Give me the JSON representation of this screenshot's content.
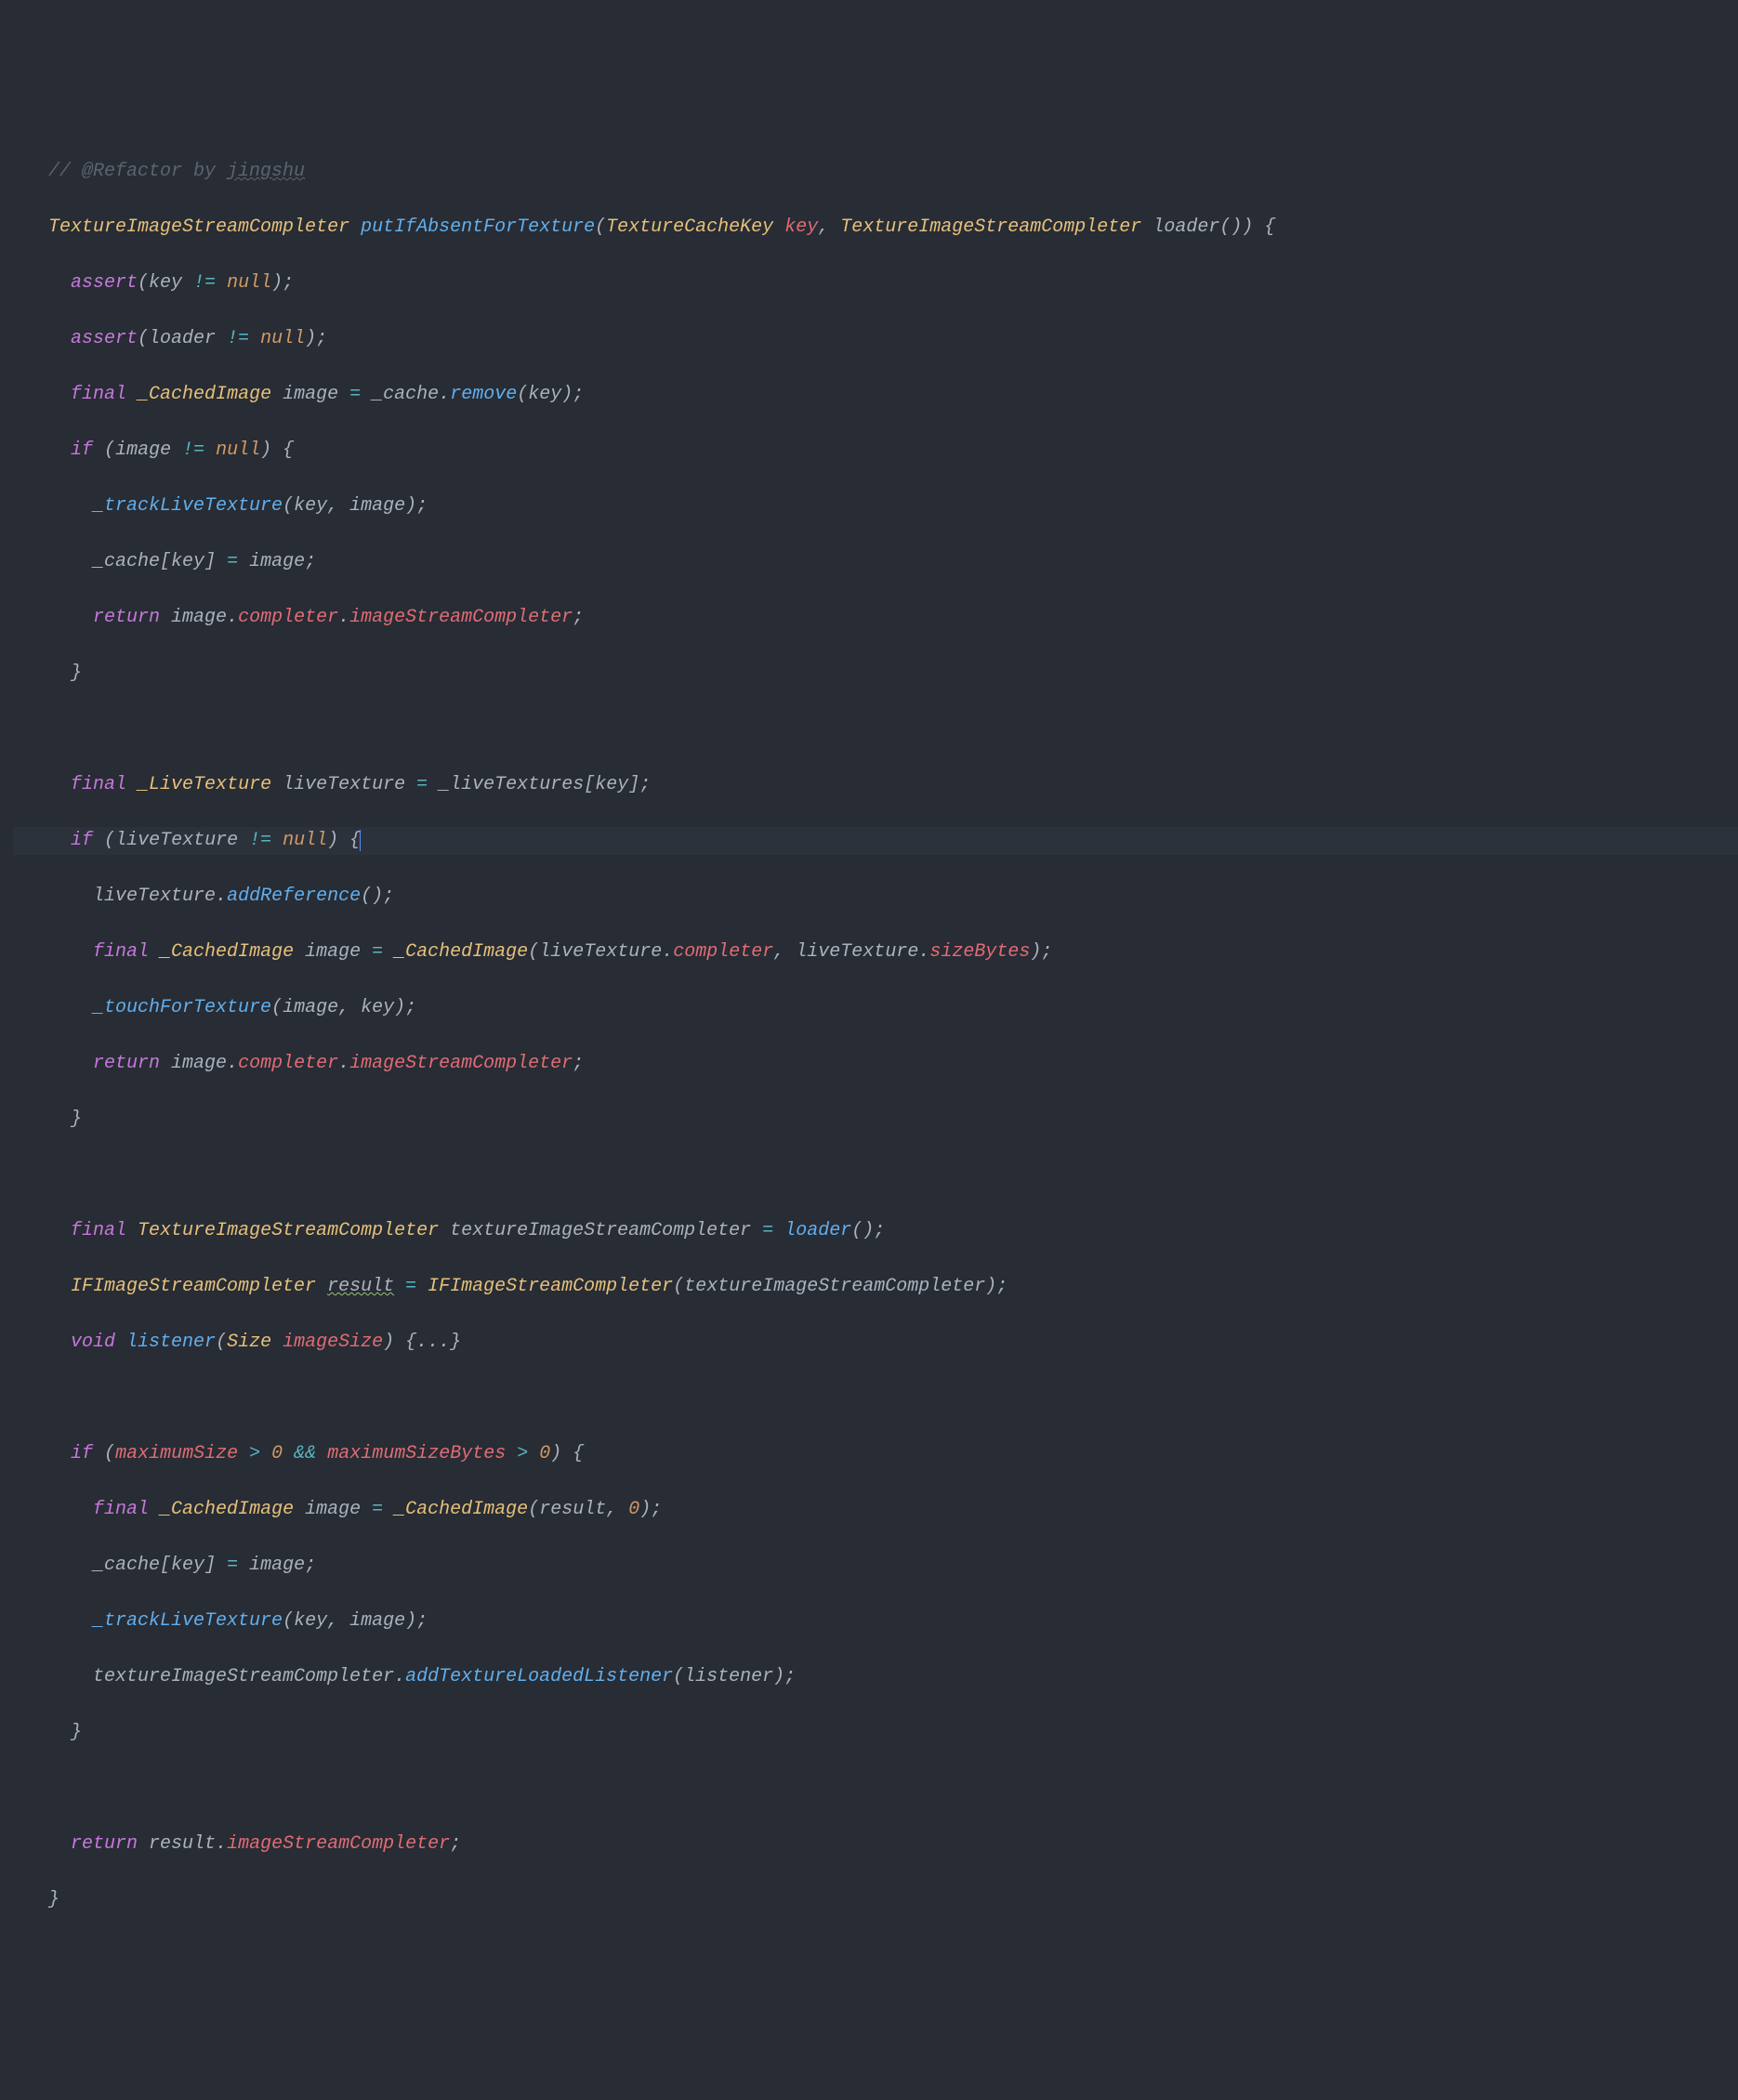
{
  "comment_prefix": "// @Refactor by ",
  "author": "jingshu",
  "t_completer": "TextureImageStreamCompleter",
  "fn_name": "putIfAbsentForTexture",
  "t_cachekey": "TextureCacheKey",
  "p_key": "key",
  "p_loader": "loader",
  "kw_assert": "assert",
  "kw_null": "null",
  "kw_final": "final",
  "kw_if": "if",
  "kw_return": "return",
  "kw_void": "void",
  "t_cachedimage": "_CachedImage",
  "v_image": "image",
  "v_cache": "_cache",
  "m_remove": "remove",
  "m_trackLive": "_trackLiveTexture",
  "prop_completer": "completer",
  "prop_isc": "imageStreamCompleter",
  "t_livetex": "_LiveTexture",
  "v_livetex": "liveTexture",
  "v_livetexs": "_liveTextures",
  "m_addRef": "addReference",
  "prop_sizeBytes": "sizeBytes",
  "m_touch": "_touchForTexture",
  "v_tisc": "textureImageStreamCompleter",
  "t_ifisc": "IFImageStreamCompleter",
  "v_result": "result",
  "fn_listener": "listener",
  "t_size": "Size",
  "p_imageSize": "imageSize",
  "fold": "{...}",
  "v_maxSize": "maximumSize",
  "v_maxSizeBytes": "maximumSizeBytes",
  "num_zero": "0",
  "m_addTexLoaded": "addTextureLoadedListener",
  "chart_data": null
}
